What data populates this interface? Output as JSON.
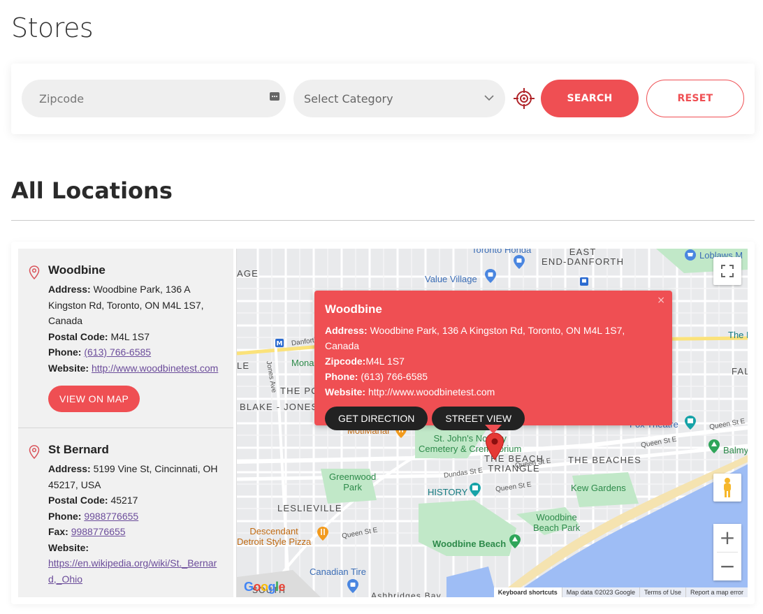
{
  "page": {
    "title": "Stores"
  },
  "search": {
    "zipcode_placeholder": "Zipcode",
    "category_placeholder": "Select Category",
    "search_label": "SEARCH",
    "reset_label": "RESET"
  },
  "locations": {
    "heading": "All Locations",
    "stores": [
      {
        "name": "Woodbine",
        "address_label": "Address:",
        "address": "Woodbine Park, 136 A Kingston Rd, Toronto, ON M4L 1S7, Canada",
        "postal_label": "Postal Code:",
        "postal": "M4L 1S7",
        "phone_label": "Phone:",
        "phone": "(613) 766-6585",
        "website_label": "Website:",
        "website": "http://www.woodbinetest.com",
        "button_label": "VIEW ON MAP"
      },
      {
        "name": "St Bernard",
        "address_label": "Address:",
        "address": "5199 Vine St, Cincinnati, OH 45217, USA",
        "postal_label": "Postal Code:",
        "postal": "45217",
        "phone_label": "Phone:",
        "phone": "9988776655",
        "fax_label": "Fax:",
        "fax": "9988776655",
        "website_label": "Website:",
        "website": "https://en.wikipedia.org/wiki/St._Bernard,_Ohio"
      }
    ]
  },
  "map": {
    "popup": {
      "title": "Woodbine",
      "close": "×",
      "address_label": "Address:",
      "address": "Woodbine Park, 136 A Kingston Rd, Toronto, ON M4L 1S7, Canada",
      "zipcode_label": "Zipcode:",
      "zipcode": "M4L 1S7",
      "phone_label": "Phone:",
      "phone": "(613) 766-6585",
      "website_label": "Website:",
      "website": "http://www.woodbinetest.com",
      "direction_label": "GET DIRECTION",
      "streetview_label": "STREET VIEW"
    },
    "labels": {
      "toronto_honda": "Toronto Honda",
      "east_danforth": "EAST\nEND-DANFORTH",
      "loblaws": "Loblaws M",
      "value_village": "Value Village",
      "danforth": "Danforth",
      "the_b": "The B",
      "age": "AGE",
      "le": "LE",
      "mona": "Mona",
      "jones_ave": "Jones Ave",
      "the_po": "THE PO",
      "blake_jones": "BLAKE - JONES",
      "fal": "FAL",
      "fox_theatre": "Fox Theatre",
      "queen_st_e_1": "Queen St E",
      "queen_st_e_2": "Queen St E",
      "queen_st_e_3": "Queen St E",
      "queen_st_e_4": "Queen St E",
      "queen_st_e_5": "Queen St E",
      "balmy": "Balmy",
      "motimahal": "MotiMahal",
      "st_johns": "St. John's Norway\nCemetery & Crematorium",
      "beach_triangle": "THE BEACH\nTRIANGLE",
      "the_beaches": "THE BEACHES",
      "greenwood_park": "Greenwood\nPark",
      "dundas_st_e": "Dundas St E",
      "history": "HISTORY",
      "kew_gardens": "Kew Gardens",
      "leslieville": "LESLIEVILLE",
      "woodbine_beach_park": "Woodbine\nBeach Park",
      "descendant": "Descendant\nDetroit Style Pizza",
      "woodbine_beach": "Woodbine Beach",
      "canadian_tire": "Canadian Tire",
      "ashbridges": "Ashbridges Bay",
      "south": "SOUTH"
    },
    "google_logo": "Google",
    "attribution": {
      "shortcuts": "Keyboard shortcuts",
      "data": "Map data ©2023 Google",
      "terms": "Terms of Use",
      "report": "Report a map error"
    },
    "zoom_in": "+",
    "zoom_out": "−",
    "colors": {
      "accent": "#ef4f53",
      "water": "#9ebdf5",
      "park": "#c1e8c8",
      "land": "#e9eaec"
    }
  }
}
